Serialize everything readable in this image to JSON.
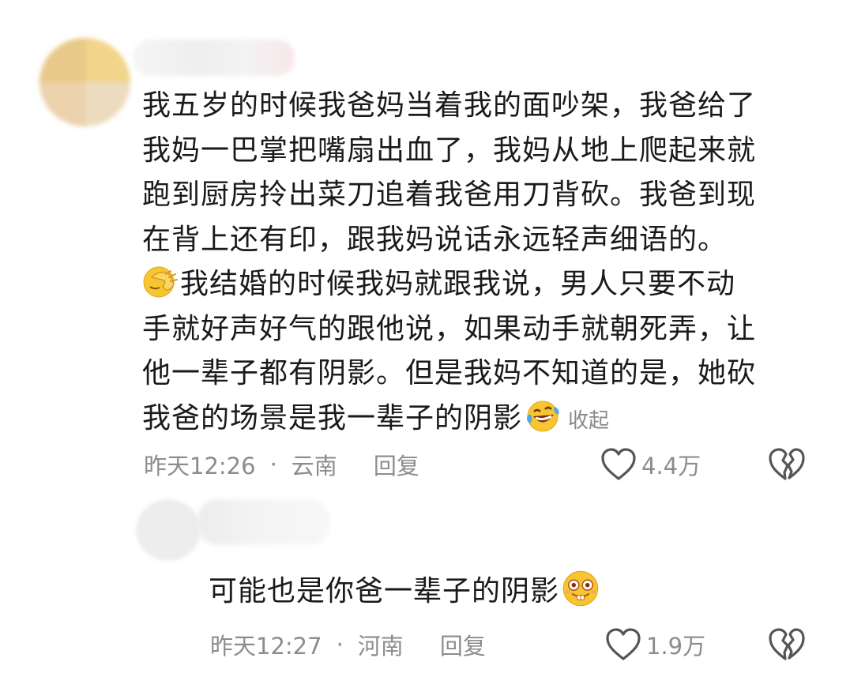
{
  "comment": {
    "lines": [
      "我五岁的时候我爸妈当着我的面吵架，我爸给了",
      "我妈一巴掌把嘴扇出血了，我妈从地上爬起来就",
      "跑到厨房拎出菜刀追着我爸用刀背砍。我爸到现",
      "在背上还有印，跟我妈说话永远轻声细语的。"
    ],
    "line5_after_emoji": "我结婚的时候我妈就跟我说，男人只要不动",
    "line6": "手就好声好气的跟他说，如果动手就朝死弄，让",
    "line7": "他一辈子都有阴影。但是我妈不知道的是，她砍",
    "line8_before_emoji": "我爸的场景是我一辈子的阴影",
    "collapse_label": "收起",
    "emoji_facepalm": "facepalm-emoji",
    "emoji_laugh_cry": "laugh-crying-emoji",
    "time": "昨天12:26",
    "separator": "·",
    "location": "云南",
    "reply_label": "回复",
    "like_count": "4.4万"
  },
  "reply": {
    "text": "可能也是你爸一辈子的阴影",
    "emoji": "goofy-face-emoji",
    "time": "昨天12:27",
    "separator": "·",
    "location": "河南",
    "reply_label": "回复",
    "like_count": "1.9万"
  },
  "icons": {
    "like": "heart-outline-icon",
    "dislike": "broken-heart-icon"
  },
  "colors": {
    "text": "#1a1a1a",
    "meta": "#8c8c8c",
    "icon_stroke": "#555555",
    "emoji_yellow": "#f7c531"
  }
}
